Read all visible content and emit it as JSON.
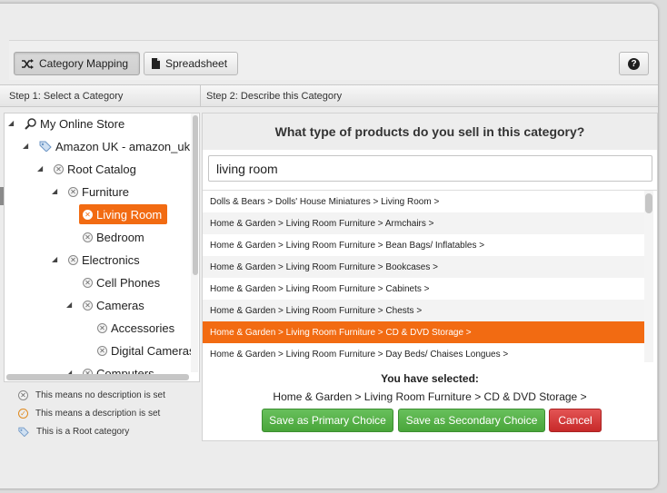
{
  "toolbar": {
    "category_mapping": "Category Mapping",
    "spreadsheet": "Spreadsheet",
    "help": "?"
  },
  "headers": {
    "step1": "Step 1: Select a Category",
    "step2": "Step 2: Describe this Category"
  },
  "tree": {
    "store": "My Online Store",
    "amazon": "Amazon UK - amazon_uk",
    "root_catalog": "Root Catalog",
    "furniture": "Furniture",
    "living_room": "Living Room",
    "bedroom": "Bedroom",
    "electronics": "Electronics",
    "cell_phones": "Cell Phones",
    "cameras": "Cameras",
    "accessories": "Accessories",
    "digital_cameras": "Digital Cameras",
    "computers": "Computers"
  },
  "legend": {
    "no_description": "This means no description is set",
    "has_description": "This means a description is set",
    "root_category": "This is a Root category"
  },
  "describe": {
    "question": "What type of products do you sell in this category?",
    "search_value": "living room",
    "results": [
      "Dolls & Bears > Dolls' House Miniatures > Living Room >",
      "Home & Garden > Living Room Furniture > Armchairs >",
      "Home & Garden > Living Room Furniture > Bean Bags/ Inflatables >",
      "Home & Garden > Living Room Furniture > Bookcases >",
      "Home & Garden > Living Room Furniture > Cabinets >",
      "Home & Garden > Living Room Furniture > Chests >",
      "Home & Garden > Living Room Furniture > CD & DVD Storage >",
      "Home & Garden > Living Room Furniture > Day Beds/ Chaises Longues >"
    ],
    "selected_index": 6,
    "you_have_selected": "You have selected:",
    "selected_path": "Home & Garden > Living Room Furniture > CD & DVD Storage >",
    "save_primary": "Save as Primary Choice",
    "save_secondary": "Save as Secondary Choice",
    "cancel": "Cancel"
  },
  "colors": {
    "accent": "#f26b12",
    "green": "#49a53a",
    "red": "#c72929"
  }
}
